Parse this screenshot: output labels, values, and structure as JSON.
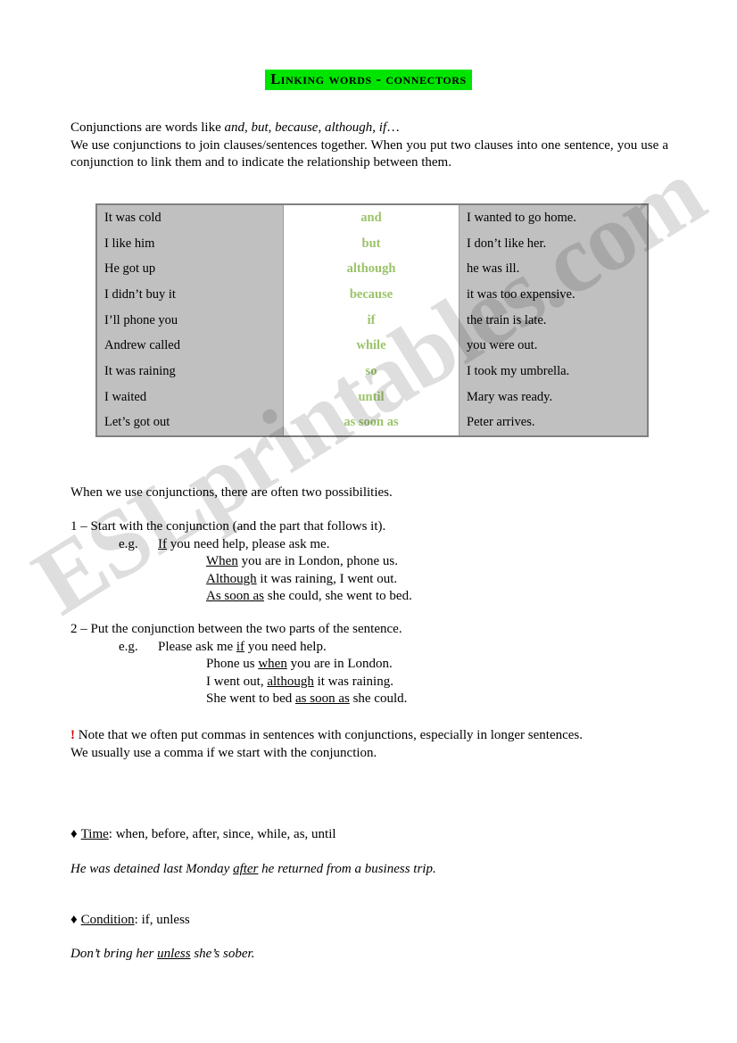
{
  "document": {
    "title": "Linking words - connectors",
    "title_highlight_color": "#00e500",
    "conjunction_color": "#9bc369",
    "table_bg_color": "#c0c0c0",
    "note_marker_color": "#cc0000"
  },
  "watermark": {
    "text": "ESLprintables.com"
  },
  "intro": {
    "line1_a": "Conjunctions are words like ",
    "line1_italic": "and, but, because, although, if",
    "line1_b": "…",
    "line2": "We use conjunctions to join clauses/sentences together. When you put two clauses into one sentence, you use a conjunction to link them and to indicate the relationship between them."
  },
  "table": {
    "rows": [
      {
        "left": "It was cold",
        "conjunction": "and",
        "right": "I wanted to go home."
      },
      {
        "left": "I like him",
        "conjunction": "but",
        "right": "I don’t like her."
      },
      {
        "left": "He got up",
        "conjunction": "although",
        "right": "he was ill."
      },
      {
        "left": "I didn’t buy it",
        "conjunction": "because",
        "right": "it was too expensive."
      },
      {
        "left": "I’ll phone you",
        "conjunction": "if",
        "right": "the train is late."
      },
      {
        "left": "Andrew called",
        "conjunction": "while",
        "right": "you were out."
      },
      {
        "left": "It was raining",
        "conjunction": "so",
        "right": "I took my umbrella."
      },
      {
        "left": "I waited",
        "conjunction": "until",
        "right": "Mary was ready."
      },
      {
        "left": "Let’s got out",
        "conjunction": "as soon as",
        "right": "Peter arrives."
      }
    ]
  },
  "possibilities": {
    "intro": "When we use conjunctions, there are often two possibilities."
  },
  "rule1": {
    "heading": "1 – Start with the conjunction (and the part that follows it).",
    "eg_label": "e.g.",
    "examples": [
      {
        "underlined": "If",
        "rest": " you need help, please ask me."
      },
      {
        "underlined": "When",
        "rest": " you are in London, phone us."
      },
      {
        "underlined": "Although",
        "rest": " it was raining, I went out."
      },
      {
        "underlined": "As soon as",
        "rest": " she could, she went to bed."
      }
    ]
  },
  "rule2": {
    "heading": "2 – Put the conjunction between the two parts of the sentence.",
    "eg_label": "e.g.",
    "examples": [
      {
        "before": "Please ask me ",
        "underlined": "if",
        "after": " you need help."
      },
      {
        "before": "Phone us ",
        "underlined": "when",
        "after": " you are in London."
      },
      {
        "before": "I went out, ",
        "underlined": "although",
        "after": " it was raining."
      },
      {
        "before": "She went to bed ",
        "underlined": "as soon as",
        "after": " she could."
      }
    ]
  },
  "note": {
    "marker": "!",
    "line1": " Note that we often put commas in sentences with conjunctions, especially in longer sentences.",
    "line2": "We usually use a comma if we start with the conjunction."
  },
  "categories": [
    {
      "bullet": "♦",
      "name": "Time",
      "separator": ": ",
      "words": "when, before, after, since, while, as, until",
      "example_before": "He was detained last Monday ",
      "example_underlined": "after",
      "example_after": " he returned from a business trip."
    },
    {
      "bullet": "♦",
      "name": "Condition",
      "separator": ": ",
      "words": "if, unless",
      "example_before": "Don’t bring her ",
      "example_underlined": "unless",
      "example_after": " she’s sober."
    }
  ]
}
